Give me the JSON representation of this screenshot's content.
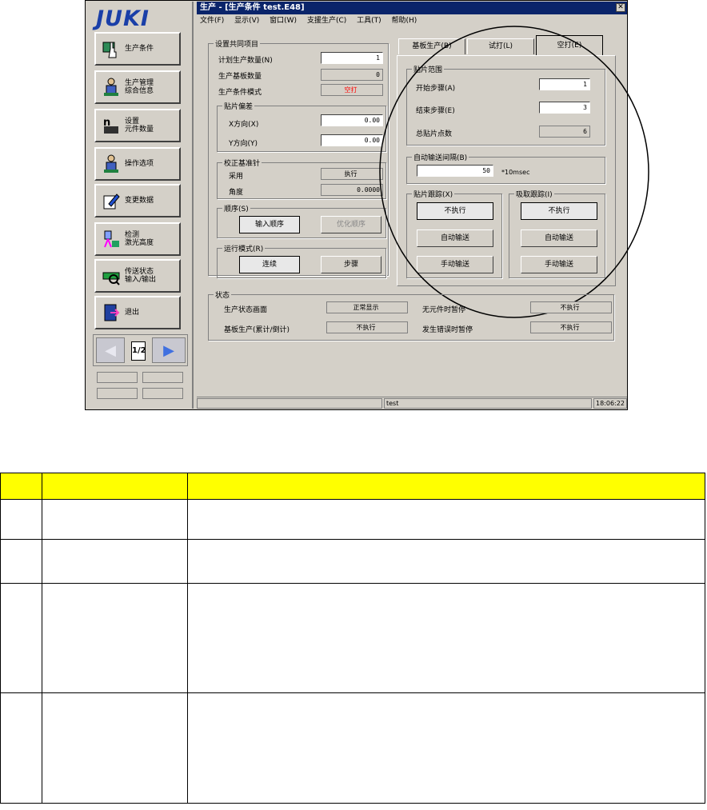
{
  "sidebar": {
    "logo": "JUKI",
    "buttons": [
      {
        "label": "生产条件",
        "icon": "hand-cursor-icon"
      },
      {
        "label": "生产管理\n综合信息",
        "icon": "operator-icon"
      },
      {
        "label": "设置\n元件数量",
        "icon": "counter-icon"
      },
      {
        "label": "操作选项",
        "icon": "operator-icon"
      },
      {
        "label": "变更数据",
        "icon": "edit-pencil-icon"
      },
      {
        "label": "检测\n激光高度",
        "icon": "laser-icon"
      },
      {
        "label": "传送状态\n输入/输出",
        "icon": "conveyor-icon"
      },
      {
        "label": "退出",
        "icon": "exit-door-icon"
      }
    ],
    "page_indicator": "1/2"
  },
  "window": {
    "title": "生产 - [生产条件 test.E48]",
    "menu": [
      "文件(F)",
      "显示(V)",
      "窗口(W)",
      "支援生产(C)",
      "工具(T)",
      "帮助(H)"
    ]
  },
  "common": {
    "title": "设置共同项目",
    "plan_qty_label": "计划生产数量(N)",
    "plan_qty": "1",
    "board_qty_label": "生产基板数量",
    "board_qty": "0",
    "mode_label": "生产条件模式",
    "mode_value": "空打"
  },
  "offset": {
    "title": "贴片偏差",
    "x_label": "X方向(X)",
    "x": "0.00",
    "y_label": "Y方向(Y)",
    "y": "0.00"
  },
  "fiducial": {
    "title": "校正基准针",
    "use_label": "采用",
    "use_value": "执行",
    "angle_label": "角度",
    "angle_value": "0.0000"
  },
  "order": {
    "title": "顺序(S)",
    "input_order": "输入顺序",
    "opt_order": "优化顺序"
  },
  "run_mode": {
    "title": "运行模式(R)",
    "continuous": "连续",
    "step": "步骤"
  },
  "tabs": [
    "基板生产(B)",
    "试打(L)",
    "空打(E)"
  ],
  "range": {
    "title": "贴片范围",
    "start_label": "开始步骤(A)",
    "start": "1",
    "end_label": "结束步骤(E)",
    "end": "3",
    "total_label": "总贴片点数",
    "total": "6"
  },
  "auto_interval": {
    "title": "自动输送间隔(B)",
    "value": "50",
    "unit": "*10msec"
  },
  "place_track": {
    "title": "贴片跟踪(X)",
    "btn1": "不执行",
    "btn2": "自动输送",
    "btn3": "手动输送"
  },
  "pick_track": {
    "title": "吸取跟踪(I)",
    "btn1": "不执行",
    "btn2": "自动输送",
    "btn3": "手动输送"
  },
  "status": {
    "title": "状态",
    "screen_label": "生产状态画面",
    "screen_value": "正常显示",
    "no_part_label": "无元件时暂停",
    "no_part_value": "不执行",
    "board_label": "基板生产(累计/倒计)",
    "board_value": "不执行",
    "error_label": "发生错误时暂停",
    "error_value": "不执行"
  },
  "statusbar": {
    "text": "test",
    "time": "18:06:22"
  },
  "colors": {
    "title_bar": "#0a246a",
    "logo": "#1a3fa8",
    "mode_text": "#ff0000",
    "table_header": "#ffff00"
  }
}
